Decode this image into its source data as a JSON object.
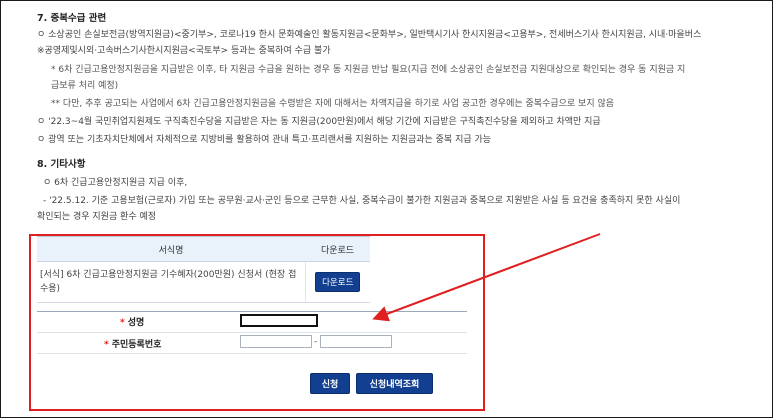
{
  "section7": {
    "title": "7. 중복수급 관련",
    "line1": "ㅇ 소상공인 손실보전금(방역지원금)<중기부>, 코로나19 한시 문화예술인 활동지원금<문화부>, 일반택시기사 한시지원금<고용부>, 전세버스기사 한시지원금, 시내·마을버스",
    "line2": "※공영제및시외·고속버스기사한시지원금<국토부> 등과는 중복하여 수급 불가",
    "line3": "* 6차 긴급고용안정지원금을 지급받은 이후, 타 지원금 수급을 원하는 경우 동 지원금 반납 필요(지급 전에 소상공인 손실보전금 지원대상으로 확인되는 경우 동 지원금 지",
    "line4": "급보류 처리 예정)",
    "line5": "** 다만, 추후 공고되는 사업에서 6차 긴급고용안정지원금을 수령받은 자에 대해서는 차액지급을 하기로 사업 공고한 경우에는 중복수급으로 보지 않음",
    "line6": "ㅇ '22.3~4월 국민취업지원제도 구직촉진수당을 지급받은 자는 동 지원금(200만원)에서 해당 기간에 지급받은 구직촉진수당을 제외하고 차액만 지급",
    "line7": "ㅇ 광역 또는 기초자치단체에서 자체적으로 지방비를 활용하여 관내 특고·프리랜서를 지원하는 지원금과는 중복 지급 가능"
  },
  "section8": {
    "title": "8. 기타사항",
    "line1": "ㅇ 6차 긴급고용안정지원금 지급 이후,",
    "line2": "- '22.5.12. 기준 고용보험(근로자) 가입 또는 공무원·교사·군인 등으로 근무한 사실, 중복수급이 불가한 지원금과 중복으로 지원받은 사실 등 요건을 충족하지 못한 사실이",
    "line3": "확인되는 경우 지원금 환수 예정"
  },
  "forms_table": {
    "col_form": "서식명",
    "col_download": "다운로드",
    "row_name_line1": "[서식] 6차 긴급고용안정지원금 기수혜자(200만원) 신청서 (현장 접",
    "row_name_line2": "수용)",
    "row_download_label": "다운로드"
  },
  "form": {
    "name_label": "성명",
    "rrn_label": "주민등록번호",
    "name_value": "",
    "rrn_front_value": "",
    "rrn_back_value": "",
    "rrn_separator": "-",
    "required_mark": "*"
  },
  "buttons": {
    "apply": "신청",
    "history": "신청내역조회"
  },
  "colors": {
    "accent": "#123f8f",
    "highlight_box": "#e02020",
    "table_header": "#e9f1fb"
  }
}
